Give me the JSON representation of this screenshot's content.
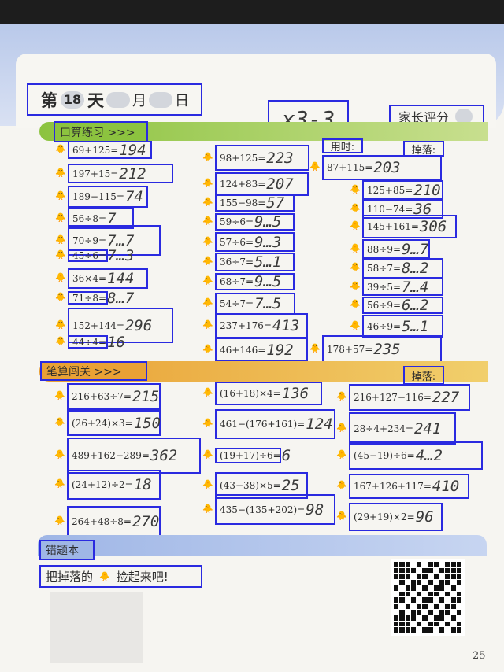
{
  "header": {
    "day_prefix": "第",
    "day_number": "18",
    "day_suffix": "天",
    "month_label": "月",
    "date_label": "日",
    "parent_rating": "家长评分",
    "handwritten_note": "x3-3"
  },
  "section1": {
    "title": "口算练习 >>>",
    "time_label": "用时:",
    "drop_label": "掉落:",
    "items": [
      {
        "q": "69+125=",
        "a": "194"
      },
      {
        "q": "197+15=",
        "a": "212"
      },
      {
        "q": "189−115=",
        "a": "74"
      },
      {
        "q": "56÷8=",
        "a": "7"
      },
      {
        "q": "70÷9=",
        "a": "7…7"
      },
      {
        "q": "45÷6=",
        "a": "7…3"
      },
      {
        "q": "36×4=",
        "a": "144"
      },
      {
        "q": "71÷8=",
        "a": "8…7"
      },
      {
        "q": "152+144=",
        "a": "296"
      },
      {
        "q": "44÷4=",
        "a": "16"
      },
      {
        "q": "98+125=",
        "a": "223"
      },
      {
        "q": "124+83=",
        "a": "207"
      },
      {
        "q": "155−98=",
        "a": "57"
      },
      {
        "q": "59÷6=",
        "a": "9…5"
      },
      {
        "q": "57÷6=",
        "a": "9…3"
      },
      {
        "q": "36÷7=",
        "a": "5…1"
      },
      {
        "q": "68÷7=",
        "a": "9…5"
      },
      {
        "q": "54÷7=",
        "a": "7…5"
      },
      {
        "q": "237+176=",
        "a": "413"
      },
      {
        "q": "46+146=",
        "a": "192"
      },
      {
        "q": "87+115=",
        "a": "203"
      },
      {
        "q": "125+85=",
        "a": "210"
      },
      {
        "q": "110−74=",
        "a": "36"
      },
      {
        "q": "145+161=",
        "a": "306"
      },
      {
        "q": "88÷9=",
        "a": "9…7"
      },
      {
        "q": "58÷7=",
        "a": "8…2"
      },
      {
        "q": "39÷5=",
        "a": "7…4"
      },
      {
        "q": "56÷9=",
        "a": "6…2"
      },
      {
        "q": "46÷9=",
        "a": "5…1"
      },
      {
        "q": "178+57=",
        "a": "235"
      }
    ]
  },
  "section2": {
    "title": "笔算闯关 >>>",
    "drop_label": "掉落:",
    "items": [
      {
        "q": "216+63÷7=",
        "a": "215"
      },
      {
        "q": "(26+24)×3=",
        "a": "150"
      },
      {
        "q": "489+162−289=",
        "a": "362"
      },
      {
        "q": "(24+12)÷2=",
        "a": "18"
      },
      {
        "q": "264+48÷8=",
        "a": "270"
      },
      {
        "q": "(16+18)×4=",
        "a": "136"
      },
      {
        "q": "461−(176+161)=",
        "a": "124"
      },
      {
        "q": "(19+17)÷6=",
        "a": "6"
      },
      {
        "q": "(43−38)×5=",
        "a": "25"
      },
      {
        "q": "435−(135+202)=",
        "a": "98"
      },
      {
        "q": "216+127−116=",
        "a": "227"
      },
      {
        "q": "28÷4+234=",
        "a": "241"
      },
      {
        "q": "(45−19)÷6=",
        "a": "4…2"
      },
      {
        "q": "167+126+117=",
        "a": "410"
      },
      {
        "q": "(29+19)×2=",
        "a": "96"
      }
    ]
  },
  "footer": {
    "wrong_book": "错题本",
    "pick_up_prefix": "把掉落的",
    "pick_up_suffix": "捡起来吧!",
    "page_number": "25"
  }
}
